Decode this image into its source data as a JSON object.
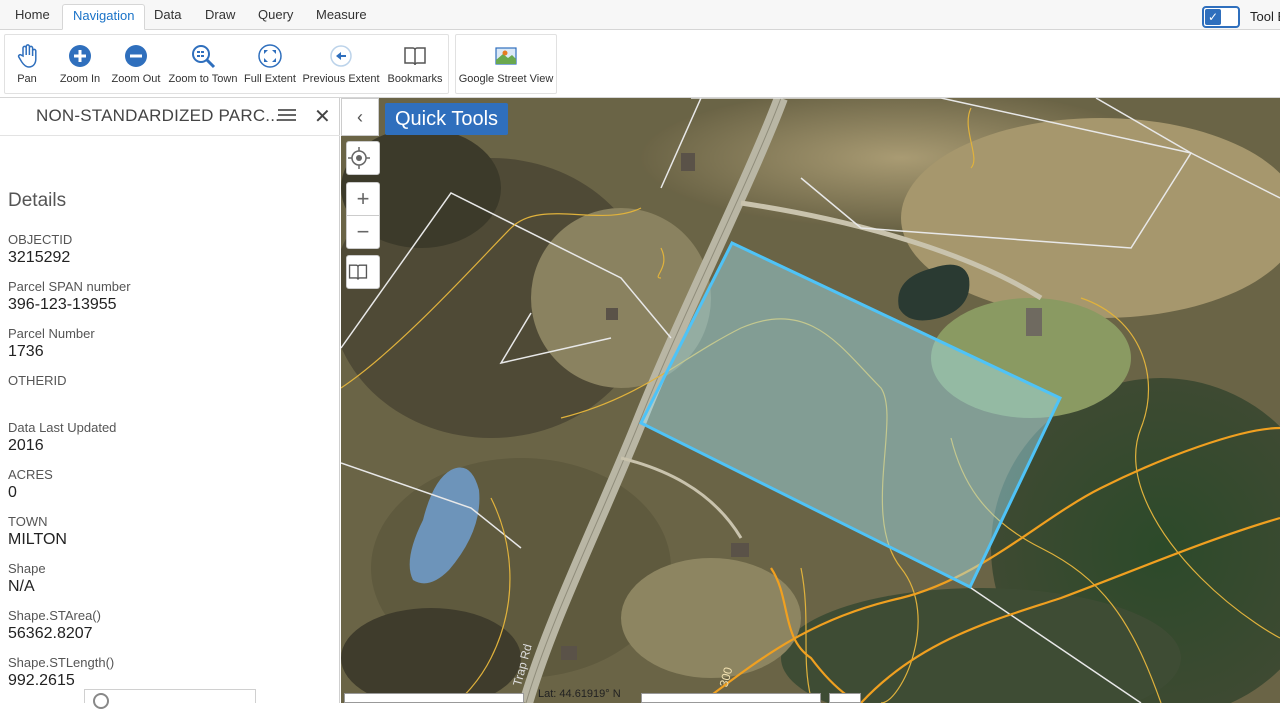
{
  "tabs": [
    "Home",
    "Navigation",
    "Data",
    "Draw",
    "Query",
    "Measure"
  ],
  "active_tab": "Navigation",
  "tool_toggle": {
    "label": "Tool B",
    "checked": true
  },
  "toolbar": {
    "navigation_tools": [
      {
        "label": "Pan",
        "icon": "hand-icon"
      },
      {
        "label": "Zoom In",
        "icon": "zoom-in-icon"
      },
      {
        "label": "Zoom Out",
        "icon": "zoom-out-icon"
      },
      {
        "label": "Zoom to Town",
        "icon": "zoom-to-town-icon"
      },
      {
        "label": "Full Extent",
        "icon": "full-extent-icon"
      },
      {
        "label": "Previous Extent",
        "icon": "previous-extent-icon"
      },
      {
        "label": "Bookmarks",
        "icon": "book-icon"
      }
    ],
    "street_view": {
      "label": "Google Street View",
      "icon": "street-view-icon"
    }
  },
  "panel": {
    "title": "NON-STANDARDIZED PARC...",
    "details_heading": "Details",
    "fields": [
      {
        "key": "OBJECTID",
        "value": "3215292"
      },
      {
        "key": "Parcel SPAN number",
        "value": "396-123-13955"
      },
      {
        "key": "Parcel Number",
        "value": "1736"
      },
      {
        "key": "OTHERID",
        "value": ""
      },
      {
        "key": "Data Last Updated",
        "value": "2016"
      },
      {
        "key": "ACRES",
        "value": "0"
      },
      {
        "key": "TOWN",
        "value": "MILTON"
      },
      {
        "key": "Shape",
        "value": "N/A"
      },
      {
        "key": "Shape.STArea()",
        "value": "56362.8207"
      },
      {
        "key": "Shape.STLength()",
        "value": "992.2615"
      }
    ]
  },
  "map": {
    "quick_tools_label": "Quick Tools",
    "coordinate_readout": "Lat: 44.61919° N",
    "road_label": "Trap Rd",
    "road_number": "300",
    "colors": {
      "parcel_outline": "#4fc3f7",
      "parcel_fill": "#9fe3f5",
      "contour": "#e0b23c",
      "parcel_lines": "#e8e8e8",
      "accent": "#2f6fbd"
    }
  }
}
